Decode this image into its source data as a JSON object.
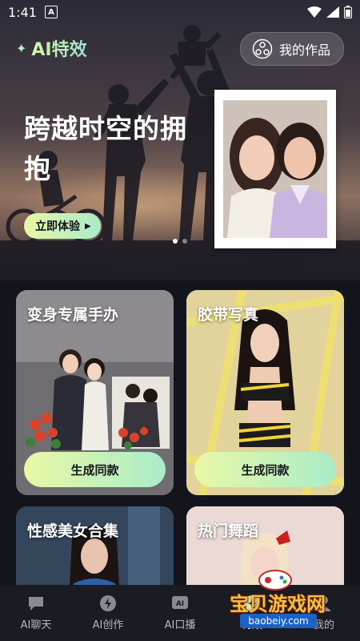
{
  "status": {
    "time": "1:41",
    "notification_icon": "A"
  },
  "header": {
    "brand": "AI特效",
    "works_button": "我的作品"
  },
  "banner": {
    "title": "跨越时空的拥抱",
    "cta": "立即体验",
    "page_count": 2,
    "active_page": 1
  },
  "cards": [
    {
      "title": "变身专属手办",
      "button": "生成同款"
    },
    {
      "title": "胶带写真",
      "button": "生成同款"
    },
    {
      "title": "性感美女合集"
    },
    {
      "title": "热门舞蹈"
    }
  ],
  "tabbar": {
    "items": [
      {
        "label": "AI聊天"
      },
      {
        "label": "AI创作"
      },
      {
        "label": "AI口播"
      },
      {
        "label": "特效"
      },
      {
        "label": "我的"
      }
    ],
    "active_index": 3
  },
  "watermark": {
    "title": "宝贝游戏网",
    "url": "baobeiy.com"
  },
  "colors": {
    "background": "#14141c",
    "accent_start": "#e9f8a6",
    "accent_end": "#a9ecc9",
    "tabbar": "#1b1b22"
  }
}
